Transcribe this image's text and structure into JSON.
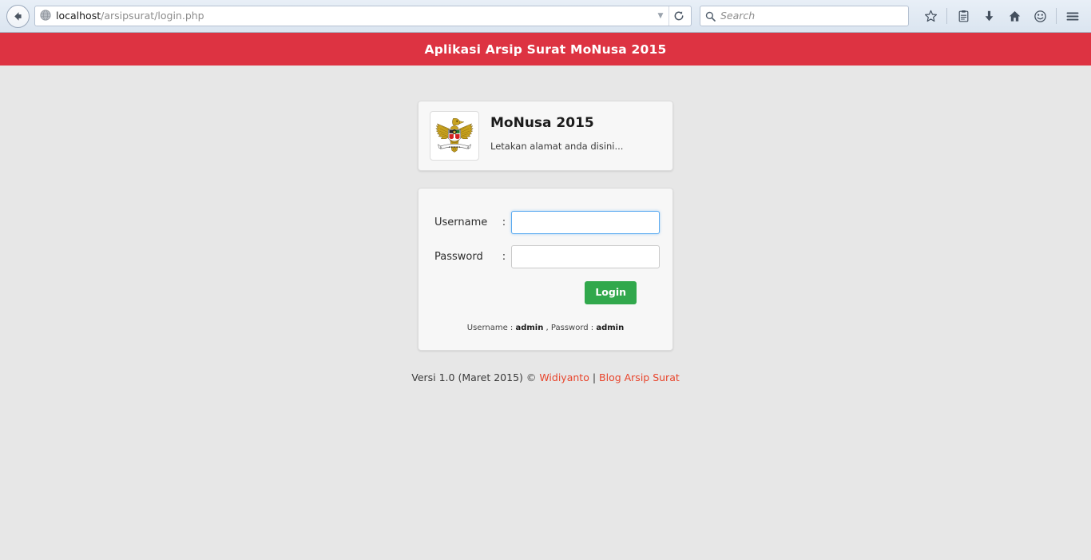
{
  "browser": {
    "back_button": "back-arrow",
    "url_host": "localhost",
    "url_path": "/arsipsurat/login.php",
    "url_dropdown": "▼",
    "reload_label": "⟳",
    "search_placeholder": "Search",
    "icons": [
      {
        "name": "bookmark-star-icon",
        "glyph": "☆"
      },
      {
        "name": "reading-list-icon",
        "glyph": "clipboard"
      },
      {
        "name": "downloads-icon",
        "glyph": "download"
      },
      {
        "name": "home-icon",
        "glyph": "home"
      },
      {
        "name": "feedback-smiley-icon",
        "glyph": "smiley"
      },
      {
        "name": "menu-hamburger-icon",
        "glyph": "hamburger"
      }
    ]
  },
  "app": {
    "header_title": "Aplikasi Arsip Surat MoNusa 2015",
    "header_color": "#dd3342"
  },
  "brand": {
    "logo_alt": "garuda-pancasila-emblem",
    "title": "MoNusa 2015",
    "subtitle": "Letakan alamat anda disini..."
  },
  "login": {
    "username_label": "Username",
    "password_label": "Password",
    "colon": ":",
    "username_value": "",
    "password_value": "",
    "username_placeholder": "",
    "password_placeholder": "",
    "submit_label": "Login",
    "submit_color": "#31a84c",
    "hint_prefix": "Username : ",
    "hint_username": "admin",
    "hint_middle": " , Password : ",
    "hint_password": "admin"
  },
  "footer": {
    "version_text": "Versi 1.0 (Maret 2015) © ",
    "author_link": "Widiyanto",
    "divider": " | ",
    "blog_link": "Blog Arsip Surat",
    "link_color": "#e8452c"
  }
}
